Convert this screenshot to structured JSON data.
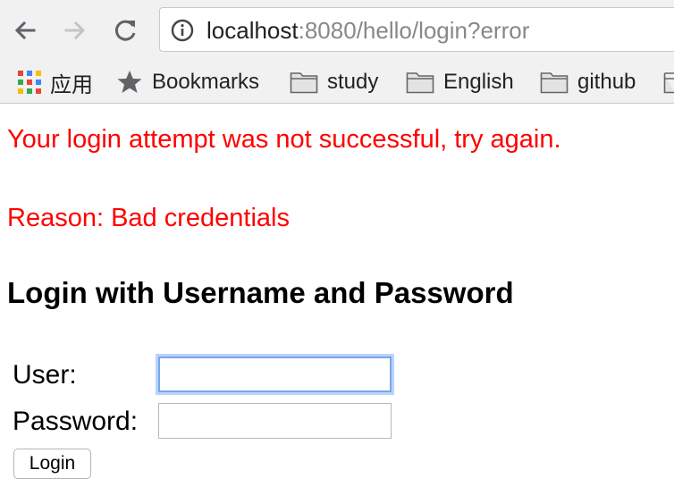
{
  "browser": {
    "url_host": "localhost",
    "url_rest": ":8080/hello/login?error",
    "bookmarks": [
      {
        "label": "应用",
        "icon": "apps-grid-icon"
      },
      {
        "label": "Bookmarks",
        "icon": "star-icon"
      },
      {
        "label": "study",
        "icon": "folder-icon"
      },
      {
        "label": "English",
        "icon": "folder-icon"
      },
      {
        "label": "github",
        "icon": "folder-icon"
      }
    ]
  },
  "page": {
    "error_message": "Your login attempt was not successful, try again.",
    "error_reason": "Reason: Bad credentials",
    "heading": "Login with Username and Password",
    "form": {
      "user_label": "User:",
      "user_value": "",
      "password_label": "Password:",
      "password_value": "",
      "submit_label": "Login"
    }
  },
  "colors": {
    "error": "#ff0000",
    "toolbar": "#f1f1f1",
    "focus_ring": "#7aa7e6"
  }
}
